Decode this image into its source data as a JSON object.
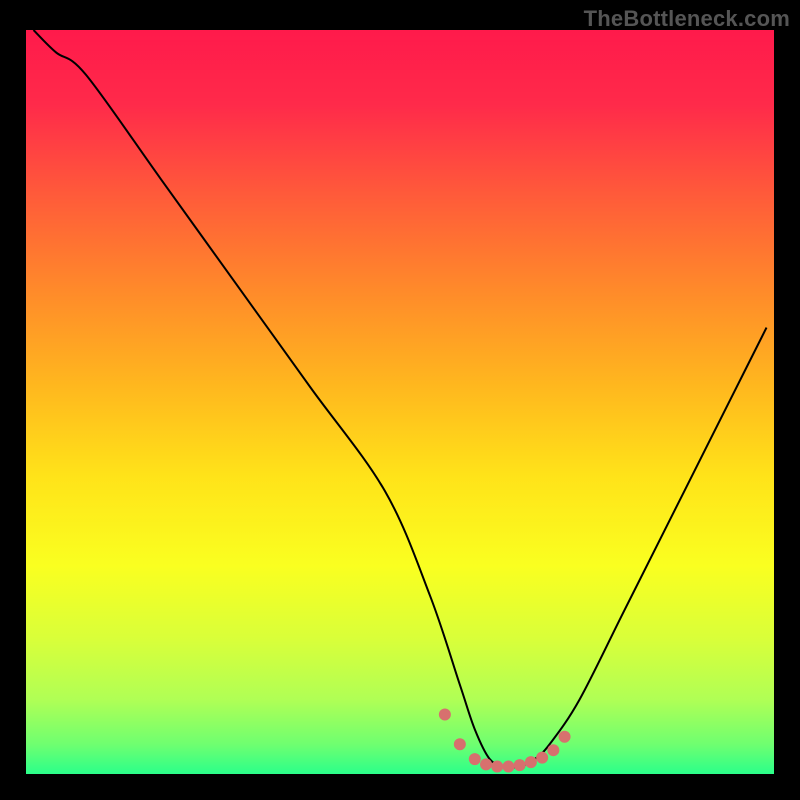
{
  "watermark": "TheBottleneck.com",
  "gradient": {
    "stops": [
      {
        "offset": 0.0,
        "color": "#ff1a4b"
      },
      {
        "offset": 0.1,
        "color": "#ff2a4a"
      },
      {
        "offset": 0.22,
        "color": "#ff5a3a"
      },
      {
        "offset": 0.35,
        "color": "#ff8a2a"
      },
      {
        "offset": 0.48,
        "color": "#ffb81e"
      },
      {
        "offset": 0.6,
        "color": "#ffe319"
      },
      {
        "offset": 0.72,
        "color": "#faff20"
      },
      {
        "offset": 0.82,
        "color": "#d8ff3a"
      },
      {
        "offset": 0.9,
        "color": "#b0ff55"
      },
      {
        "offset": 0.96,
        "color": "#6fff70"
      },
      {
        "offset": 1.0,
        "color": "#2bff8a"
      }
    ]
  },
  "chart_data": {
    "type": "line",
    "title": "",
    "xlabel": "",
    "ylabel": "",
    "xlim": [
      0,
      100
    ],
    "ylim": [
      0,
      100
    ],
    "series": [
      {
        "name": "curve",
        "x": [
          1,
          4,
          8,
          18,
          28,
          38,
          48,
          54,
          58,
          60,
          62,
          64,
          66,
          68,
          70,
          74,
          80,
          88,
          96,
          99
        ],
        "y": [
          100,
          97,
          94,
          80,
          66,
          52,
          38,
          24,
          12,
          6,
          2,
          1,
          1,
          2,
          4,
          10,
          22,
          38,
          54,
          60
        ]
      }
    ],
    "annotations": {
      "trough_markers_x": [
        56,
        58,
        60,
        61.5,
        63,
        64.5,
        66,
        67.5,
        69,
        70.5,
        72
      ],
      "trough_markers_y": [
        8,
        4,
        2,
        1.3,
        1,
        1,
        1.2,
        1.6,
        2.2,
        3.2,
        5
      ],
      "marker_color": "#d7706e",
      "marker_radius": 6
    }
  }
}
